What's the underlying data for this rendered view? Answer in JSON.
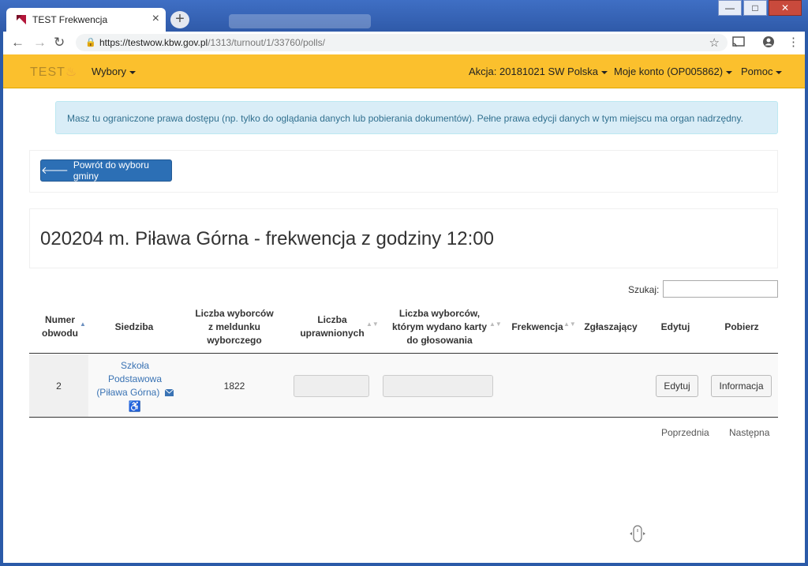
{
  "browser": {
    "tab_title": "TEST Frekwencja",
    "tab_close": "×",
    "new_tab": "+",
    "url_host": "https://testwow.kbw.gov.pl",
    "url_path": "/1313/turnout/1/33760/polls/",
    "window_buttons": {
      "minimize": "—",
      "maximize": "□",
      "close": "✕"
    }
  },
  "navbar": {
    "brand": "TEST",
    "menu_wybory": "Wybory",
    "menu_akcja": "Akcja: 20181021 SW Polska",
    "menu_konto": "Moje konto (OP005862)",
    "menu_pomoc": "Pomoc"
  },
  "alert": {
    "text": "Masz tu ograniczone prawa dostępu (np. tylko do oglądania danych lub pobierania dokumentów). Pełne prawa edycji danych w tym miejscu ma organ nadrzędny."
  },
  "back_button": "Powrót do wyboru gminy",
  "title": "020204 m. Piława Górna - frekwencja z godziny 12:00",
  "search": {
    "label": "Szukaj:",
    "value": ""
  },
  "table": {
    "headers": {
      "numer": "Numer obwodu",
      "siedziba": "Siedziba",
      "meldunek": "Liczba wyborców z meldunku wyborczego",
      "uprawnionych": "Liczba uprawnionych",
      "karty": "Liczba wyborców, którym wydano karty do głosowania",
      "frekwencja": "Frekwencja",
      "zglaszajacy": "Zgłaszający",
      "edytuj": "Edytuj",
      "pobierz": "Pobierz"
    },
    "rows": [
      {
        "numer": "2",
        "siedziba_line1": "Szkoła",
        "siedziba_line2": "Podstawowa",
        "siedziba_line3": "(Piława Górna)",
        "meldunek": "1822",
        "edit_label": "Edytuj",
        "info_label": "Informacja"
      }
    ]
  },
  "pager": {
    "prev": "Poprzednia",
    "next": "Następna"
  },
  "colors": {
    "navbar": "#fbc02d",
    "primary": "#2c6fb5",
    "alert_bg": "#d9edf7",
    "link": "#3a73b4"
  }
}
